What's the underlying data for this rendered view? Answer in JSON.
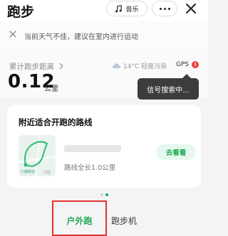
{
  "header": {
    "title": "跑步",
    "music_label": "音乐"
  },
  "notice": {
    "text": "当前天气不佳，建议在室内进行运动"
  },
  "stats": {
    "distance_label": "累计跑步距离",
    "distance_value": "0.12",
    "distance_unit": "公里",
    "weather": "14°C 轻度污染",
    "gps_label": "GPS",
    "gps_badge": "!"
  },
  "tooltip": {
    "text": "信号搜索中..."
  },
  "route_card": {
    "title": "附近适合开跑的路线",
    "map_start_label": "小鹿跑道",
    "map_end_label": "公园",
    "route_length": "路线全长1.0公里",
    "go_label": "去看看"
  },
  "tabs": {
    "outdoor": "户外跑",
    "treadmill": "跑步机"
  },
  "colors": {
    "accent": "#1faa58",
    "alert": "#e8433a",
    "highlight_border": "#e53030"
  }
}
